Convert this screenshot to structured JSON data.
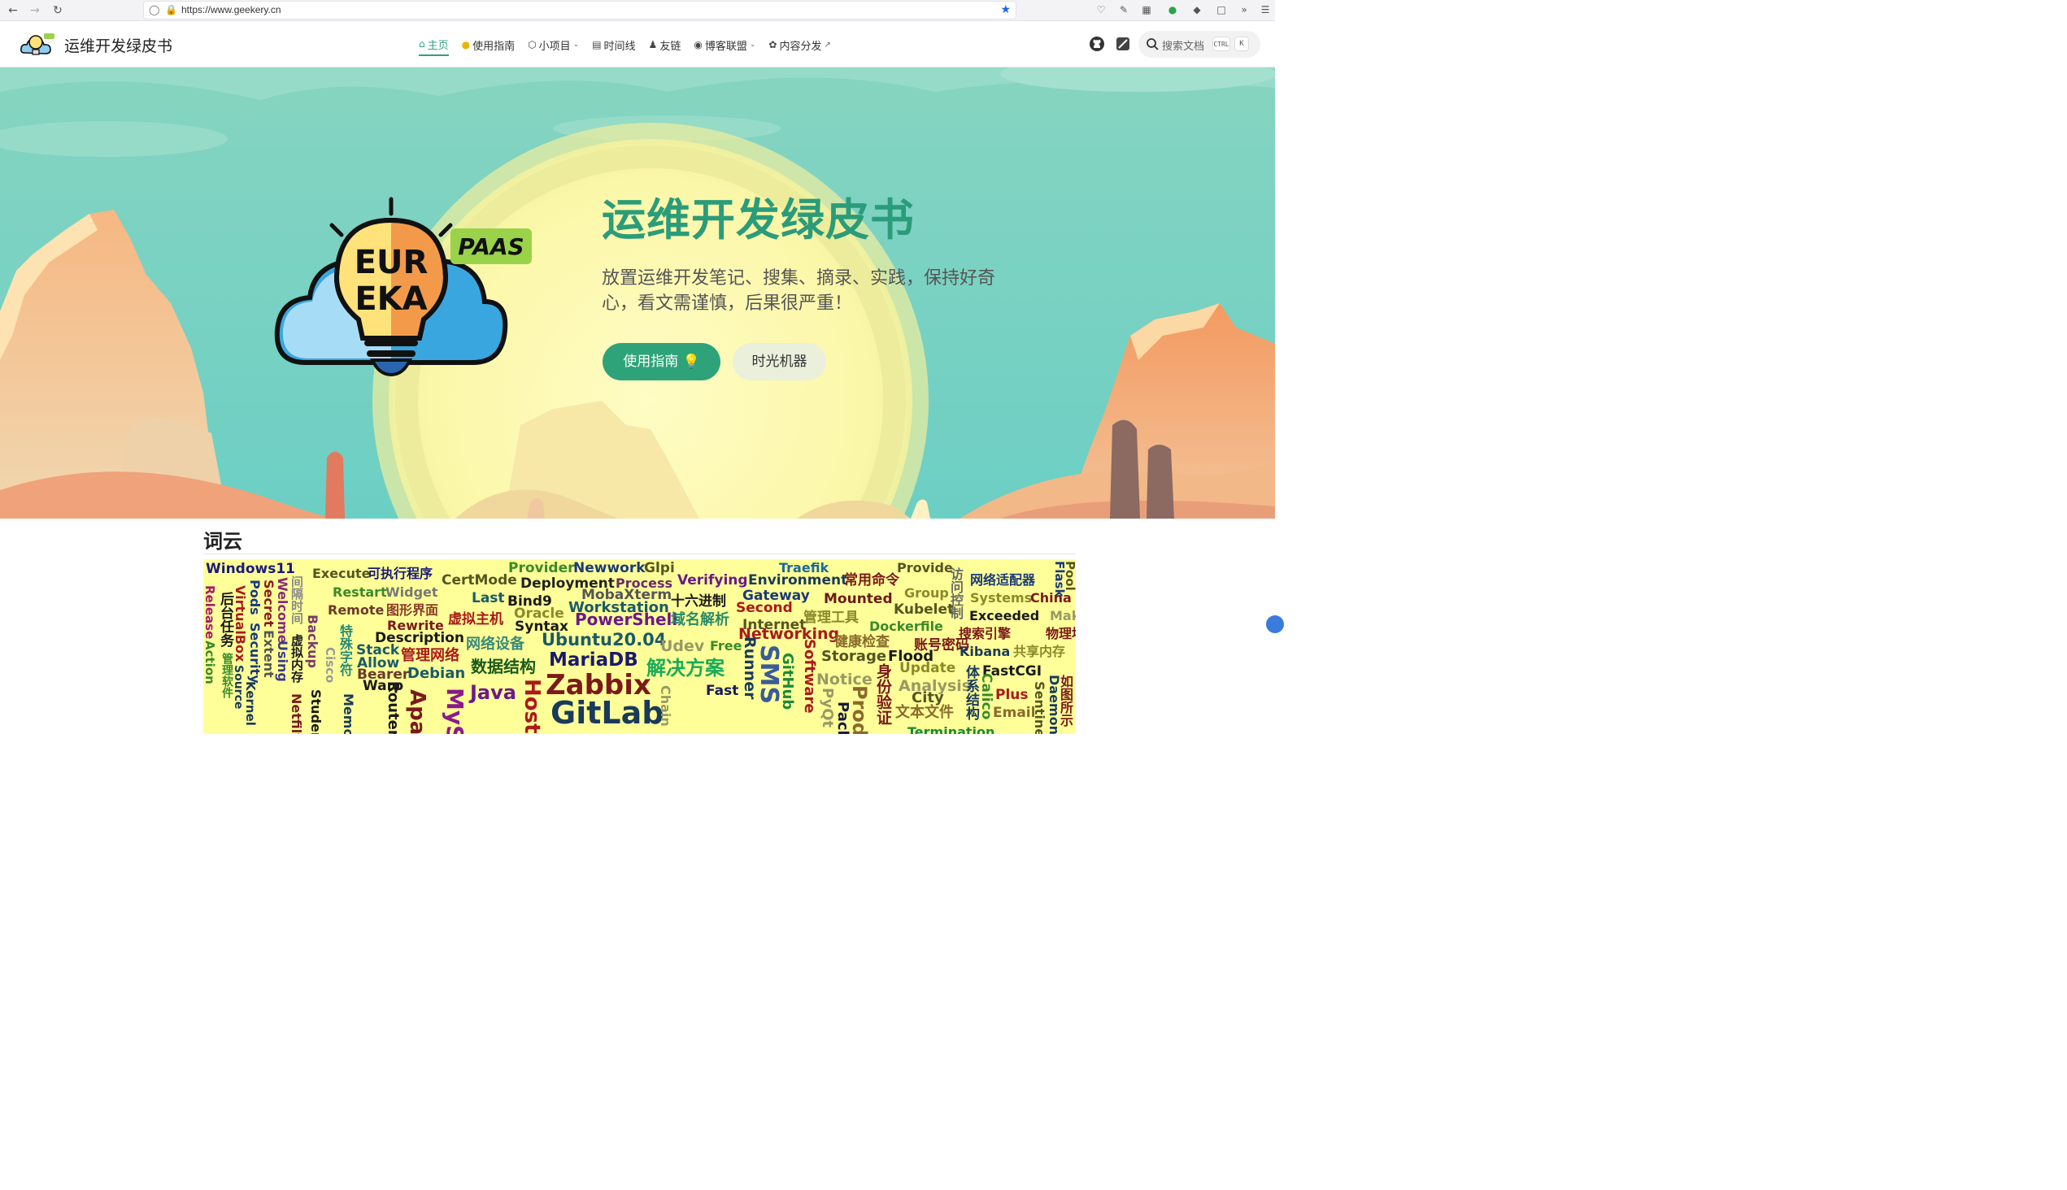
{
  "browser": {
    "url": "https://www.geekery.cn"
  },
  "header": {
    "title": "运维开发绿皮书",
    "nav": [
      {
        "label": "主页",
        "icon": "home-icon"
      },
      {
        "label": "使用指南",
        "icon": "bulb-icon"
      },
      {
        "label": "小项目",
        "icon": "cube-icon"
      },
      {
        "label": "时间线",
        "icon": "book-icon"
      },
      {
        "label": "友链",
        "icon": "users-icon"
      },
      {
        "label": "博客联盟",
        "icon": "chat-icon"
      },
      {
        "label": "内容分发",
        "icon": "share-icon"
      }
    ],
    "search_placeholder": "搜索文档",
    "kbd_ctrl": "CTRL",
    "kbd_k": "K"
  },
  "hero": {
    "logo_text_top": "EUR",
    "logo_text_bottom": "EKA",
    "logo_badge": "PAAS",
    "title": "运维开发绿皮书",
    "description": "放置运维开发笔记、搜集、摘录、实践，保持好奇心，看文需谨慎，后果很严重！",
    "primary_button": "使用指南 💡",
    "secondary_button": "时光机器"
  },
  "wordcloud": {
    "title": "词云",
    "words": [
      "Windows11",
      "Execute",
      "可执行程序",
      "Provider",
      "Newwork",
      "Glpi",
      "Traefik",
      "Provide",
      "网络适配器",
      "Flask",
      "Pool",
      "Restart",
      "Widget",
      "CertMode",
      "Deployment",
      "Process",
      "Verifying",
      "Environment",
      "常用命令",
      "Group",
      "Systems",
      "China",
      "Remote",
      "图形界面",
      "Last",
      "Bind9",
      "MobaXterm",
      "十六进制",
      "Gateway",
      "Mounted",
      "Kubelet",
      "Exceeded",
      "Make",
      "Rewrite",
      "虚拟主机",
      "Oracle",
      "Workstation",
      "Second",
      "管理工具",
      "Dockerfile",
      "搜索引擎",
      "物理地址",
      "Description",
      "Syntax",
      "PowerShell",
      "域名解析",
      "Internet",
      "Networking",
      "健康检查",
      "账号密码",
      "Kibana",
      "共享内存",
      "Stack",
      "管理网络",
      "网络设备",
      "Ubuntu20.04",
      "Udev",
      "Free",
      "Storage",
      "Flood",
      "Update",
      "FastCGI",
      "Allow",
      "Bearer",
      "Debian",
      "数据结构",
      "MariaDB",
      "解决方案",
      "Notice",
      "Analysis",
      "City",
      "Plus",
      "Email",
      "Warp",
      "Java",
      "Zabbix",
      "GitLab",
      "Fast",
      "文本文件",
      "Host",
      "Release",
      "Action",
      "后台任务",
      "VirtualBox",
      "Secret",
      "Welcome",
      "Pods",
      "Security",
      "Extent",
      "Using",
      "Backup",
      "Student",
      "Cisco",
      "特殊字符",
      "Router",
      "Runner",
      "GitHub",
      "Software",
      "PyQt",
      "身份验证",
      "体系结构",
      "Calico",
      "Sentinel",
      "Daemon",
      "如图所示",
      "访问控制",
      "间隔时间",
      "虚拟内存",
      "Apache",
      "MySQL",
      "Chain",
      "Kernel",
      "Source",
      "管理软件",
      "Netfilter",
      "Memory",
      "Termination",
      "SMS",
      "Prod",
      "Pack"
    ]
  }
}
